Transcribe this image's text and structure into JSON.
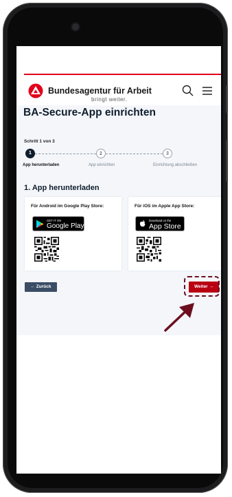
{
  "header": {
    "brand": "Bundesagentur für Arbeit",
    "tagline": "bringt weiter."
  },
  "page": {
    "title": "BA-Secure-App einrichten",
    "step_count": "Schritt 1 von 3"
  },
  "steps": [
    {
      "number": "1",
      "label": "App herunterladen",
      "active": true
    },
    {
      "number": "2",
      "label": "App einrichten",
      "active": false
    },
    {
      "number": "3",
      "label": "Einrichtung abschließen",
      "active": false
    }
  ],
  "section": {
    "title": "1. App herunterladen"
  },
  "stores": [
    {
      "title": "Für Android im Google Play Store:",
      "badge_small": "GET IT ON",
      "badge_big": "Google Play"
    },
    {
      "title": "Für iOS im Apple App Store:",
      "badge_small": "Download on the",
      "badge_big": "App Store"
    }
  ],
  "buttons": {
    "back": "← Zurück",
    "next": "Weiter →"
  },
  "colors": {
    "brand_red": "#e2001a",
    "next_button": "#b80012",
    "back_button": "#3a4d64",
    "highlight": "#6d0e1e",
    "page_band": "#f4f6fa"
  }
}
